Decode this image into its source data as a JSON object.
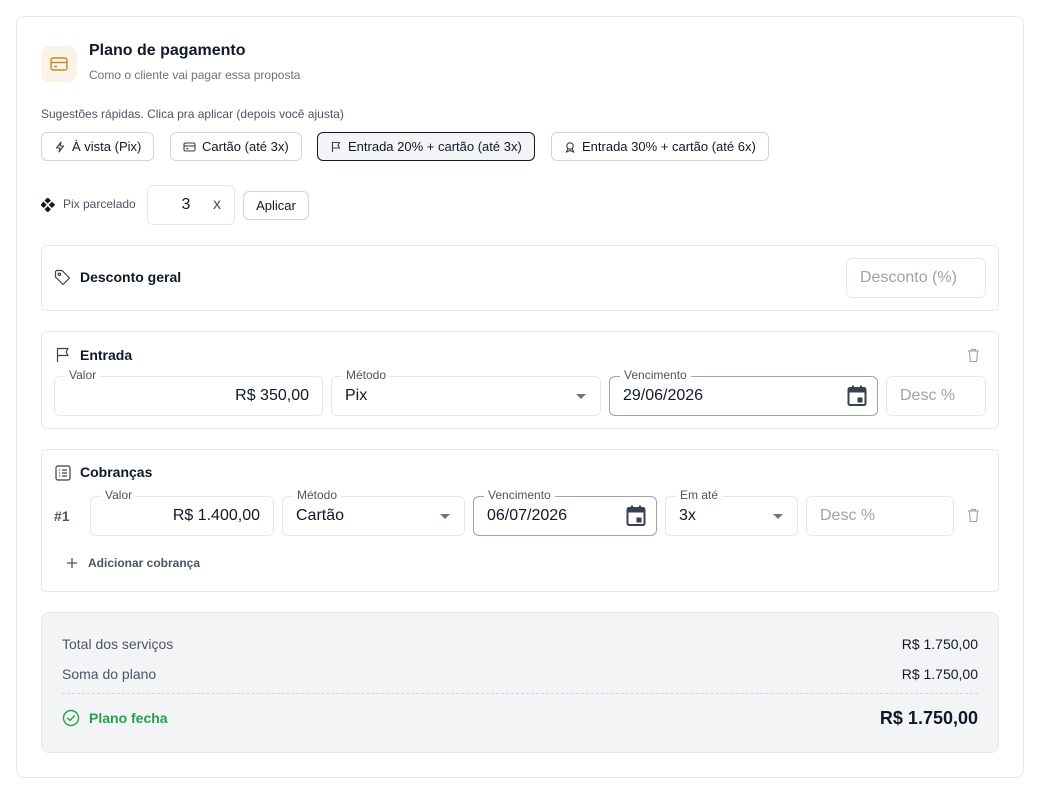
{
  "header": {
    "title": "Plano de pagamento",
    "subtitle": "Como o cliente vai pagar essa proposta",
    "icon": "credit-card-icon"
  },
  "suggestions": {
    "hint": "Sugestões rápidas. Clica pra aplicar (depois você ajusta)",
    "chips": [
      {
        "label": "À vista (Pix)",
        "icon": "lightning-icon",
        "active": false
      },
      {
        "label": "Cartão (até 3x)",
        "icon": "credit-card-icon",
        "active": false
      },
      {
        "label": "Entrada 20% + cartão (até 3x)",
        "icon": "flag-icon",
        "active": true
      },
      {
        "label": "Entrada 30% + cartão (até 6x)",
        "icon": "badge-icon",
        "active": false
      }
    ]
  },
  "pix_parcelado": {
    "label": "Pix parcelado",
    "value": "3",
    "suffix": "x",
    "apply_label": "Aplicar"
  },
  "discount": {
    "title": "Desconto geral",
    "placeholder": "Desconto (%)"
  },
  "entrada": {
    "title": "Entrada",
    "valor_label": "Valor",
    "valor": "R$ 350,00",
    "metodo_label": "Método",
    "metodo": "Pix",
    "vencimento_label": "Vencimento",
    "vencimento": "29/06/2026",
    "desc_placeholder": "Desc %"
  },
  "cobrancas": {
    "title": "Cobranças",
    "rows": [
      {
        "num": "#1",
        "valor_label": "Valor",
        "valor": "R$ 1.400,00",
        "metodo_label": "Método",
        "metodo": "Cartão",
        "vencimento_label": "Vencimento",
        "vencimento": "06/07/2026",
        "parcelas_label": "Em até",
        "parcelas": "3x",
        "desc_placeholder": "Desc %"
      }
    ],
    "add_label": "Adicionar cobrança"
  },
  "summary": {
    "total_servicos_label": "Total dos serviços",
    "total_servicos": "R$ 1.750,00",
    "soma_plano_label": "Soma do plano",
    "soma_plano": "R$ 1.750,00",
    "status_label": "Plano fecha",
    "status_total": "R$ 1.750,00",
    "status_color": "#22a150"
  }
}
